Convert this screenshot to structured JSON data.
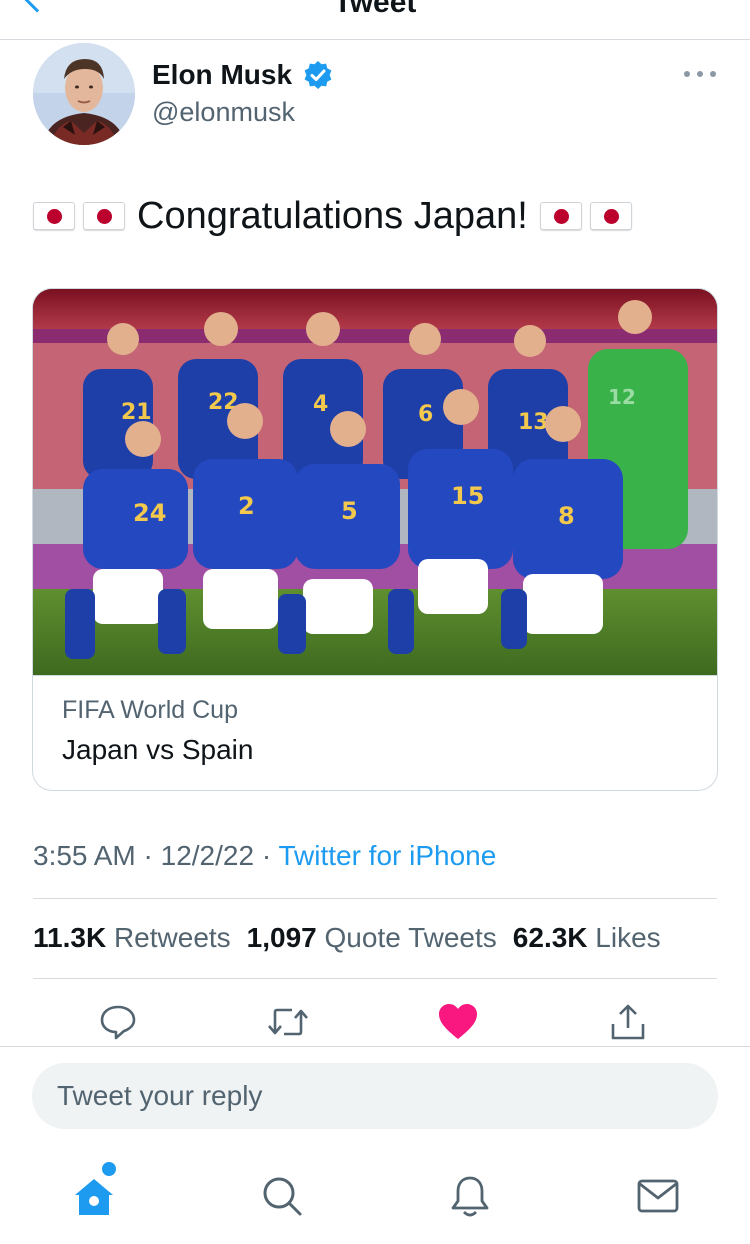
{
  "header": {
    "title": "Tweet"
  },
  "author": {
    "name": "Elon Musk",
    "handle": "@elonmusk",
    "verified": true
  },
  "tweet": {
    "text": "Congratulations Japan!",
    "flag_emoji": "🇯🇵"
  },
  "card": {
    "domain": "FIFA World Cup",
    "title": "Japan vs Spain"
  },
  "meta": {
    "time": "3:55 AM",
    "separator": "·",
    "date": "12/2/22",
    "source": "Twitter for iPhone"
  },
  "stats": {
    "retweets_count": "11.3K",
    "retweets_label": "Retweets",
    "quotes_count": "1,097",
    "quotes_label": "Quote Tweets",
    "likes_count": "62.3K",
    "likes_label": "Likes"
  },
  "actions": {
    "liked": true
  },
  "reply": {
    "placeholder": "Tweet your reply"
  },
  "icons": {
    "back": "chevron-left-icon",
    "verified": "verified-badge-icon",
    "more": "more-horizontal-icon",
    "reply": "comment-icon",
    "retweet": "retweet-icon",
    "like": "heart-icon",
    "share": "share-icon",
    "home": "home-icon",
    "search": "search-icon",
    "notifications": "bell-icon",
    "messages": "mail-icon"
  },
  "colors": {
    "accent": "#1d9bf0",
    "like": "#f91880",
    "secondary_text": "#536471",
    "flag_red": "#bc002d",
    "kit_blue": "#1f3fa8",
    "keeper_green": "#39b24a"
  }
}
